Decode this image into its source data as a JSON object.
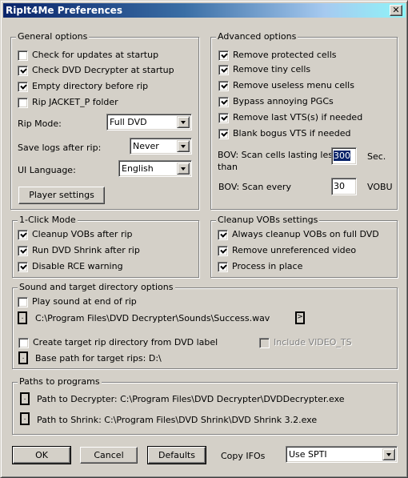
{
  "window": {
    "title": "RipIt4Me Preferences",
    "close_glyph": "✕"
  },
  "general_options": {
    "title": "General options",
    "checkboxes": [
      {
        "label": "Check for updates at startup",
        "checked": false
      },
      {
        "label": "Check DVD Decrypter at startup",
        "checked": true
      },
      {
        "label": "Empty directory before rip",
        "checked": true
      },
      {
        "label": "Rip JACKET_P folder",
        "checked": false
      }
    ],
    "rip_mode": {
      "label": "Rip Mode:",
      "value": "Full DVD"
    },
    "save_logs": {
      "label": "Save logs after rip:",
      "value": "Never"
    },
    "ui_language": {
      "label": "UI Language:",
      "value": "English"
    },
    "player_settings_label": "Player settings"
  },
  "advanced_options": {
    "title": "Advanced options",
    "checkboxes": [
      {
        "label": "Remove protected cells",
        "checked": true
      },
      {
        "label": "Remove tiny cells",
        "checked": true
      },
      {
        "label": "Remove useless menu cells",
        "checked": true
      },
      {
        "label": "Bypass annoying PGCs",
        "checked": true
      },
      {
        "label": "Remove last VTS(s) if needed",
        "checked": true
      },
      {
        "label": "Blank bogus VTS if needed",
        "checked": true
      }
    ],
    "bov_scan_cells": {
      "label_line1": "BOV: Scan cells lasting less",
      "label_line2": "than",
      "value": "300",
      "unit": "Sec."
    },
    "bov_scan_every": {
      "label": "BOV: Scan every",
      "value": "30",
      "unit": "VOBU"
    }
  },
  "one_click_mode": {
    "title": "1-Click Mode",
    "checkboxes": [
      {
        "label": "Cleanup VOBs after rip",
        "checked": true
      },
      {
        "label": "Run DVD Shrink after rip",
        "checked": true
      },
      {
        "label": "Disable RCE warning",
        "checked": true
      }
    ]
  },
  "cleanup_vobs": {
    "title": "Cleanup VOBs settings",
    "checkboxes": [
      {
        "label": "Always cleanup VOBs on full DVD",
        "checked": true
      },
      {
        "label": "Remove unreferenced video",
        "checked": true
      },
      {
        "label": "Process in place",
        "checked": true
      }
    ]
  },
  "sound_target": {
    "title": "Sound and target directory options",
    "play_sound": {
      "label": "Play sound at end of rip",
      "checked": false
    },
    "sound_path": "C:\\Program Files\\DVD Decrypter\\Sounds\\Success.wav",
    "browse_glyph": ".",
    "play_glyph": ">",
    "create_target": {
      "label": "Create target rip directory from DVD label",
      "checked": false
    },
    "include_video_ts": {
      "label": "Include VIDEO_TS",
      "checked": false,
      "disabled": true
    },
    "base_path": "Base path for target rips: D:\\"
  },
  "paths": {
    "title": "Paths to programs",
    "decrypter": "Path to Decrypter: C:\\Program Files\\DVD Decrypter\\DVDDecrypter.exe",
    "shrink": "Path to Shrink: C:\\Program Files\\DVD Shrink\\DVD Shrink 3.2.exe"
  },
  "footer": {
    "ok_label": "OK",
    "cancel_label": "Cancel",
    "defaults_label": "Defaults",
    "copy_ifos_label": "Copy IFOs",
    "copy_ifos_value": "Use SPTI"
  }
}
